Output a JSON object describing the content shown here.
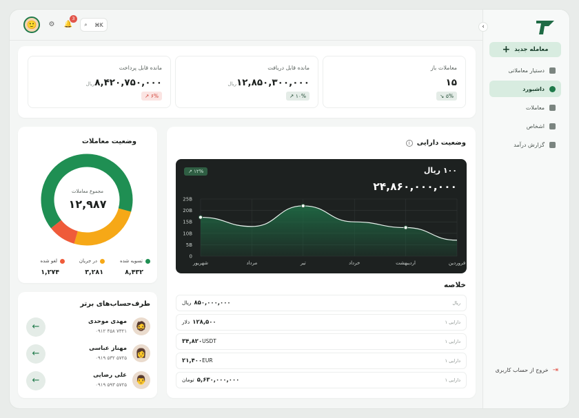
{
  "topbar": {
    "notifications_count": "3",
    "search_shortcut": "⌘K"
  },
  "sidebar": {
    "new_deal_label": "معامله جدید",
    "items": [
      {
        "label": "دستیار معاملاتی",
        "icon": "robot-icon"
      },
      {
        "label": "داشبورد",
        "icon": "pie-icon",
        "active": true
      },
      {
        "label": "معاملات",
        "icon": "deals-icon"
      },
      {
        "label": "اشخاص",
        "icon": "people-icon"
      },
      {
        "label": "گزارش درآمد",
        "icon": "report-icon"
      }
    ],
    "logout_label": "خروج از حساب کاربری"
  },
  "stats": [
    {
      "title": "معاملات باز",
      "value": "۱۵",
      "unit": "",
      "change": "۵%",
      "trend": "down"
    },
    {
      "title": "مانده قابل دریافت",
      "value": "۱۲,۸۵۰,۳۰۰,۰۰۰",
      "unit": "ریال",
      "change": "۱۰%",
      "trend": "up-green"
    },
    {
      "title": "مانده قابل پرداخت",
      "value": "۸,۴۲۰,۷۵۰,۰۰۰",
      "unit": "ریال",
      "change": "۶%",
      "trend": "up-red"
    }
  ],
  "asset": {
    "title": "وضعیت دارایی",
    "rate": "۱۰۰ ریال",
    "total": "۲۴,۸۶۰,۰۰۰,۰۰۰",
    "change": "۱۲%",
    "summary_title": "خلاصه",
    "summary": [
      {
        "tag": "ریال",
        "amount": "۸۵۰,۰۰۰,۰۰۰",
        "currency": "ریال"
      },
      {
        "tag": "دارایی ۱",
        "amount": "۱۲۸,۵۰۰",
        "currency": "دلار"
      },
      {
        "tag": "دارایی ۱",
        "amount": "۳۴,۸۲۰",
        "currency": "USDT"
      },
      {
        "tag": "دارایی ۱",
        "amount": "۲۱,۴۰۰",
        "currency": "EUR"
      },
      {
        "tag": "دارایی ۱",
        "amount": "۵,۶۳۰,۰۰۰,۰۰۰",
        "currency": "تومان"
      }
    ]
  },
  "chart_data": {
    "type": "area",
    "categories": [
      "فروردین",
      "اردیبهشت",
      "خرداد",
      "تیر",
      "مرداد",
      "شهریور"
    ],
    "values": [
      7,
      12.5,
      15,
      22,
      13,
      17
    ],
    "y_ticks": [
      "0",
      "5B",
      "10B",
      "15B",
      "20B",
      "25B"
    ],
    "ylim": [
      0,
      25
    ],
    "colors": {
      "line": "#e9f3ee",
      "fill": "#1f6b45",
      "background": "#1d2120"
    }
  },
  "deals": {
    "title": "وضعیت معاملات",
    "total_label": "مجموع معاملات",
    "total": "۱۲,۹۸۷",
    "legend": [
      {
        "label": "تسویه شده",
        "value": "۸,۴۳۲",
        "color": "#1f8f53",
        "share": 8432
      },
      {
        "label": "در جریان",
        "value": "۳,۲۸۱",
        "color": "#f6a817",
        "share": 3281
      },
      {
        "label": "لغو شده",
        "value": "۱,۲۷۴",
        "color": "#ef5b3a",
        "share": 1274
      }
    ]
  },
  "accounts": {
    "title": "طرف‌حساب‌های برتر",
    "items": [
      {
        "name": "مهدی موحدی",
        "phone": "۰۹۱۲ ۴۵۸ ۷۳۲۱"
      },
      {
        "name": "مهناز عباسی",
        "phone": "۰۹۱۹ ۵۳۲ ۵۷۲۵"
      },
      {
        "name": "علی رضایی",
        "phone": "۰۹۱۹ ۵۹۳ ۵۷۲۵"
      }
    ]
  }
}
